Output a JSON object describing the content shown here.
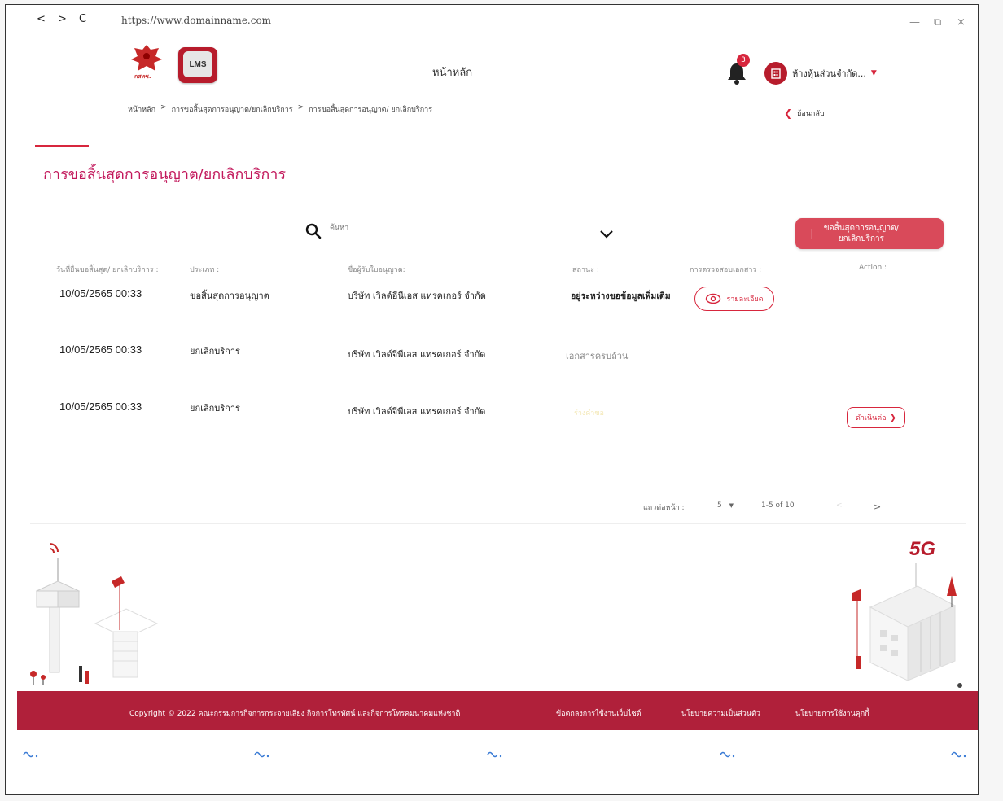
{
  "browser": {
    "back": "<",
    "forward": ">",
    "reload": "C",
    "url": "https://www.domainname.com",
    "minimize": "—",
    "restore": "⧉",
    "close": "×"
  },
  "header": {
    "garuda_caption": "กสทช.",
    "lms_label": "LMS",
    "home_title": "หน้าหลัก",
    "notification_count": "3",
    "company_name": "ห้างหุ้นส่วนจำกัด...",
    "back_label": "ย้อนกลับ"
  },
  "breadcrumb": [
    "หน้าหลัก",
    "การขอสิ้นสุดการอนุญาต/ยกเลิกบริการ",
    "การขอสิ้นสุดการอนุญาต/ ยกเลิกบริการ"
  ],
  "breadcrumb_sep": ">",
  "page_title": "การขอสิ้นสุดการอนุญาต/ยกเลิกบริการ",
  "search": {
    "placeholder": "ค้นหา"
  },
  "add_button": {
    "line1": "ขอสิ้นสุดการอนุญาต/",
    "line2": "ยกเลิกบริการ"
  },
  "table": {
    "headers": {
      "date": "วันที่ยื่นขอสิ้นสุด/ ยกเลิกบริการ :",
      "type": "ประเภท :",
      "licensee": "ชื่อผู้รับใบอนุญาต:",
      "status": "สถานะ :",
      "doc_check": "การตรวจสอบเอกสาร :",
      "action": "Action :"
    },
    "rows": [
      {
        "date": "10/05/2565 00:33",
        "type": "ขอสิ้นสุดการอนุญาต",
        "licensee": "บริษัท เวิลด์อีนีเอส แทรคเกอร์ จำกัด",
        "status": "อยู่ระหว่างขอข้อมูลเพิ่มเติม",
        "doc_check": "รายละเอียด",
        "action": ""
      },
      {
        "date": "10/05/2565 00:33",
        "type": "ยกเลิกบริการ",
        "licensee": "บริษัท เวิลด์จีพีเอส แทรคเกอร์ จำกัด",
        "status": "เอกสารครบถ้วน",
        "doc_check": "",
        "action": ""
      },
      {
        "date": "10/05/2565 00:33",
        "type": "ยกเลิกบริการ",
        "licensee": "บริษัท เวิลด์จีพีเอส แทรคเกอร์ จำกัด",
        "status": "ร่างคำขอ",
        "doc_check": "",
        "action": "ดำเนินต่อ"
      }
    ]
  },
  "pagination": {
    "rows_per_page_label": "แถวต่อหน้า :",
    "rows_per_page": "5",
    "range": "1-5 of 10",
    "prev": "<",
    "next": ">"
  },
  "illustration": {
    "badge_5g": "5G"
  },
  "footer": {
    "copyright": "Copyright © 2022 คณะกรรมการกิจการกระจายเสียง กิจการโทรทัศน์ และกิจการโทรคมนาคมแห่งชาติ",
    "terms": "ข้อตกลงการใช้งานเว็บไซต์",
    "privacy": "นโยบายความเป็นส่วนตัว",
    "cookies": "นโยบายการใช้งานคุกกี้"
  },
  "colors": {
    "brand": "#d7263d",
    "footer": "#b0203a",
    "title": "#c2185b"
  }
}
